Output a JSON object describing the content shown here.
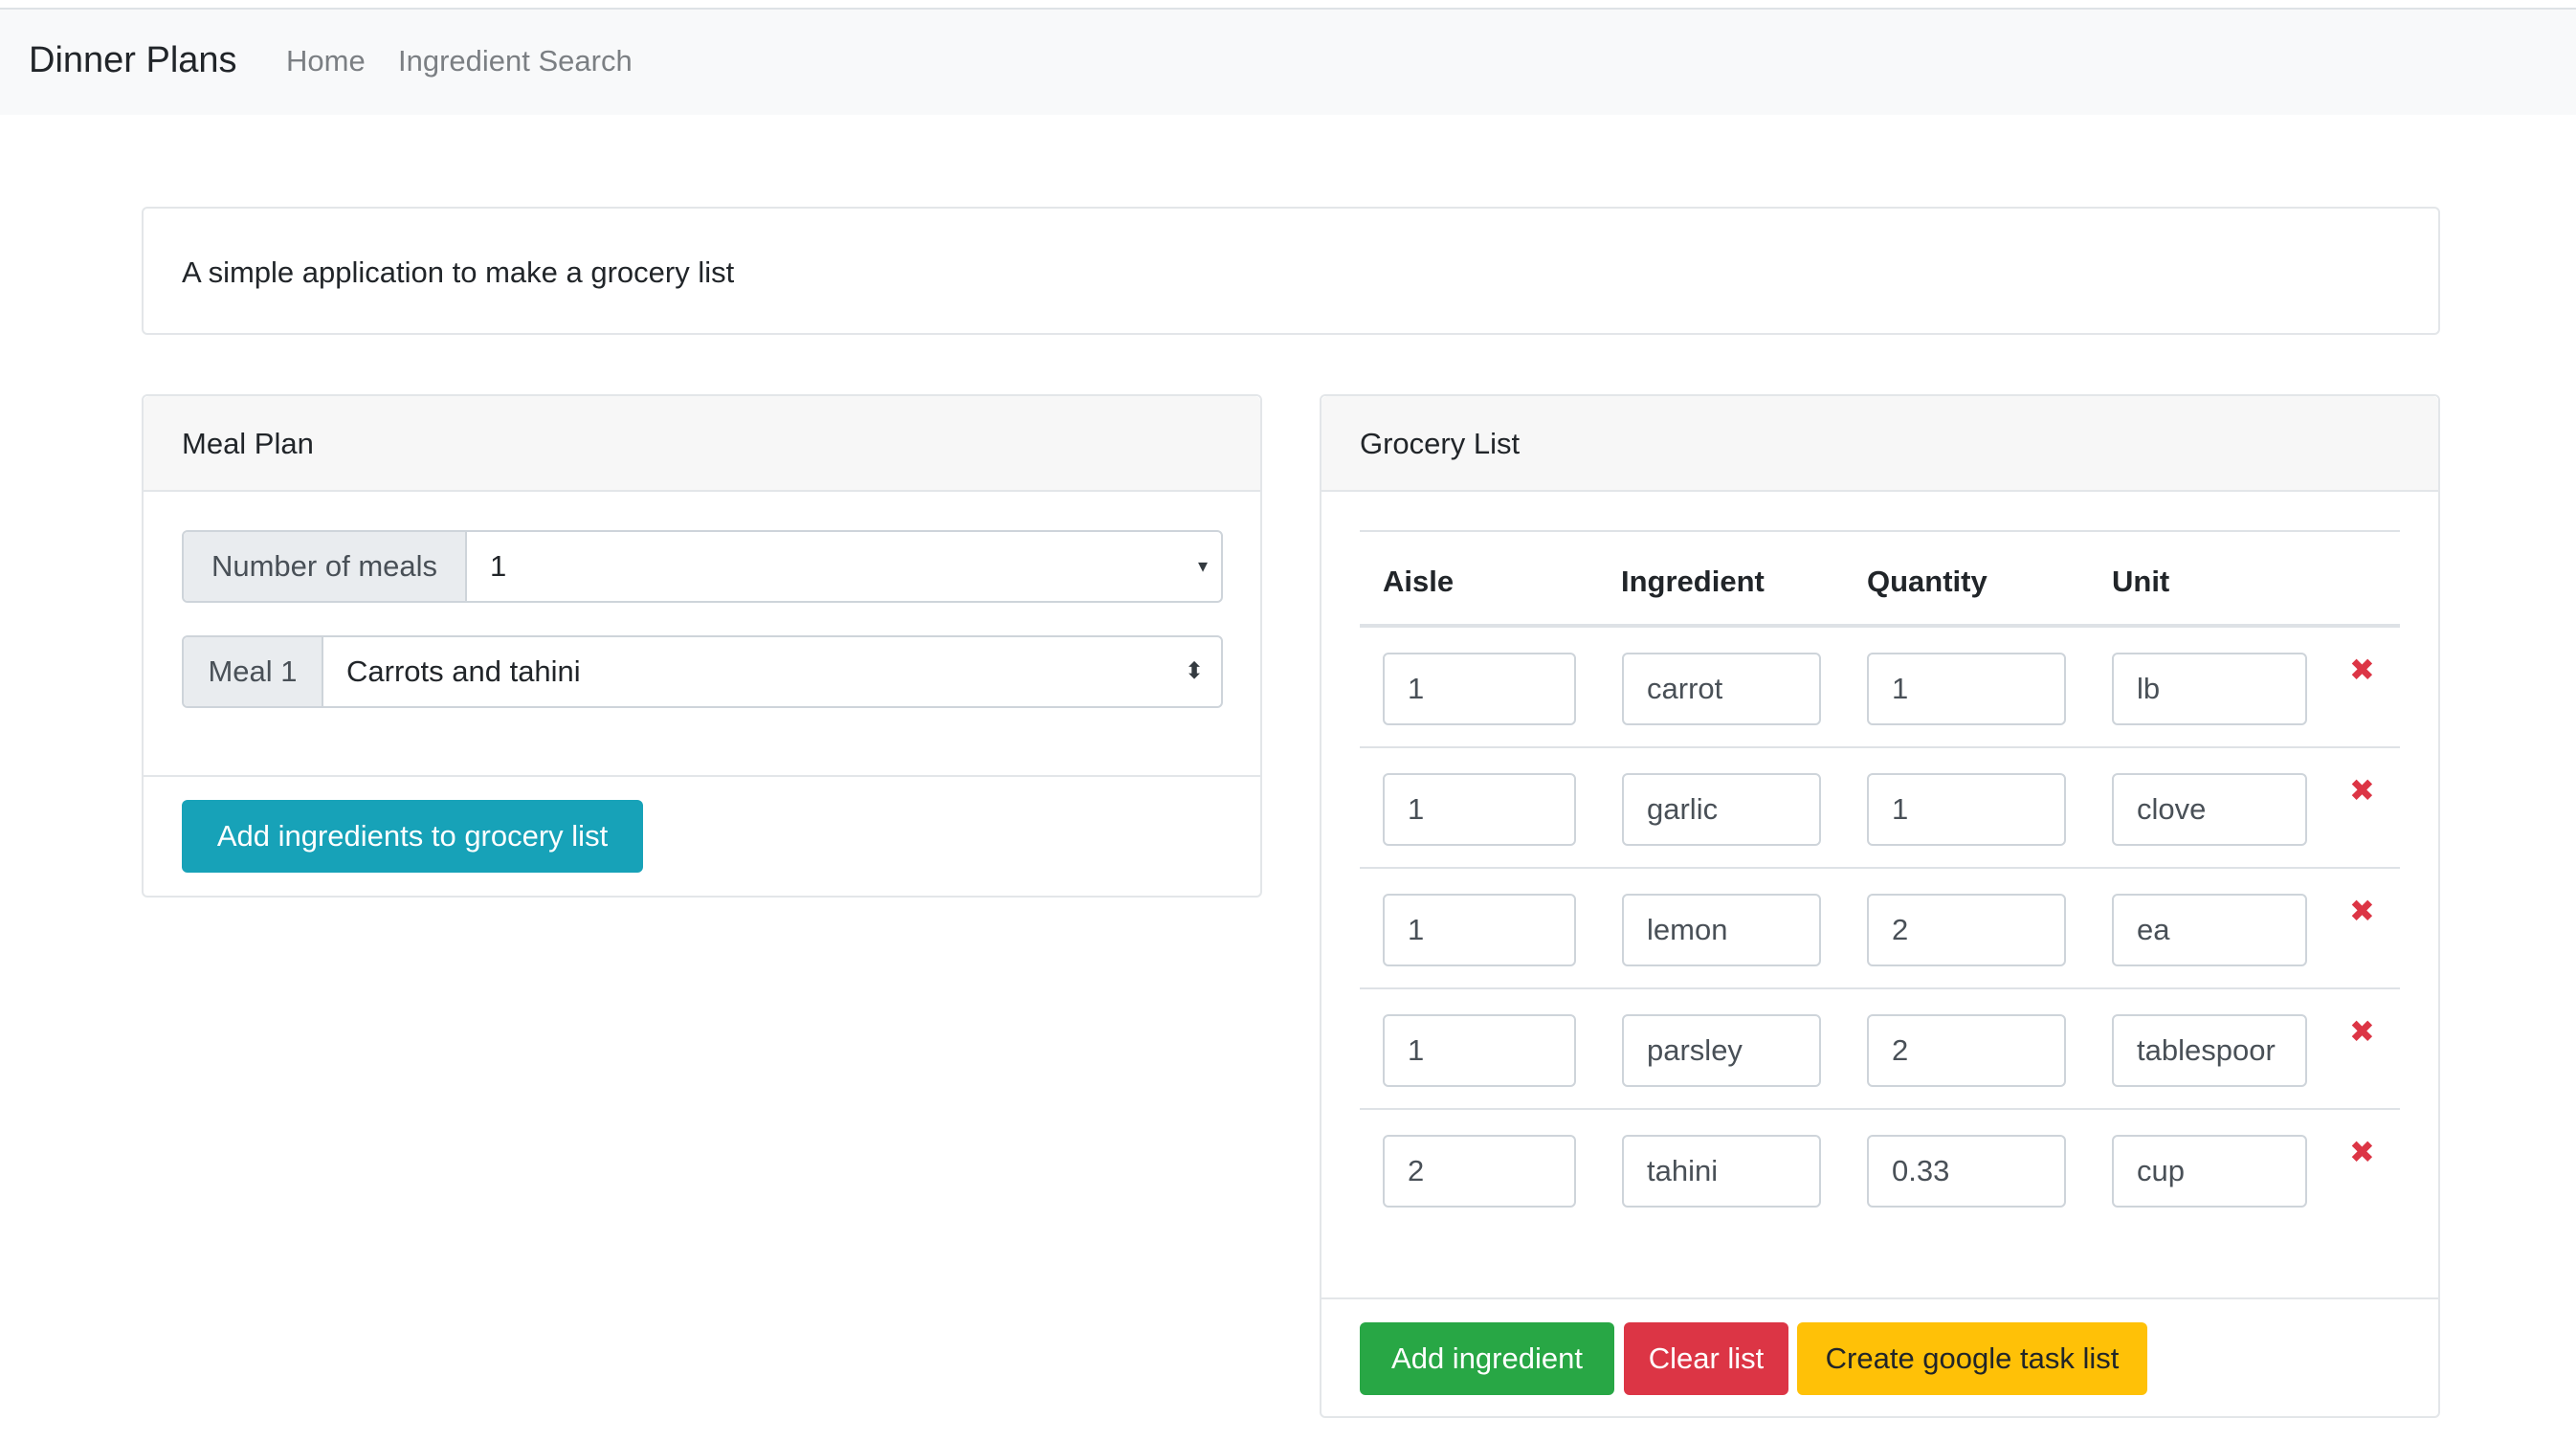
{
  "navbar": {
    "brand": "Dinner Plans",
    "links": [
      "Home",
      "Ingredient Search"
    ]
  },
  "intro": {
    "text": "A simple application to make a grocery list"
  },
  "meal_plan": {
    "title": "Meal Plan",
    "number_of_meals_label": "Number of meals",
    "number_of_meals_value": "1",
    "meal_label": "Meal 1",
    "meal_value": "Carrots and tahini",
    "add_button": "Add ingredients to grocery list"
  },
  "grocery_list": {
    "title": "Grocery List",
    "columns": [
      "Aisle",
      "Ingredient",
      "Quantity",
      "Unit"
    ],
    "rows": [
      {
        "aisle": "1",
        "ingredient": "carrot",
        "quantity": "1",
        "unit": "lb"
      },
      {
        "aisle": "1",
        "ingredient": "garlic",
        "quantity": "1",
        "unit": "clove"
      },
      {
        "aisle": "1",
        "ingredient": "lemon",
        "quantity": "2",
        "unit": "ea"
      },
      {
        "aisle": "1",
        "ingredient": "parsley",
        "quantity": "2",
        "unit": "tablespoor"
      },
      {
        "aisle": "2",
        "ingredient": "tahini",
        "quantity": "0.33",
        "unit": "cup"
      }
    ],
    "delete_icon": "✖",
    "buttons": {
      "add_ingredient": "Add ingredient",
      "clear_list": "Clear list",
      "create_google": "Create google task list"
    }
  },
  "colors": {
    "info": "#17a2b8",
    "success": "#28a745",
    "danger": "#dc3545",
    "warning": "#ffc107"
  }
}
